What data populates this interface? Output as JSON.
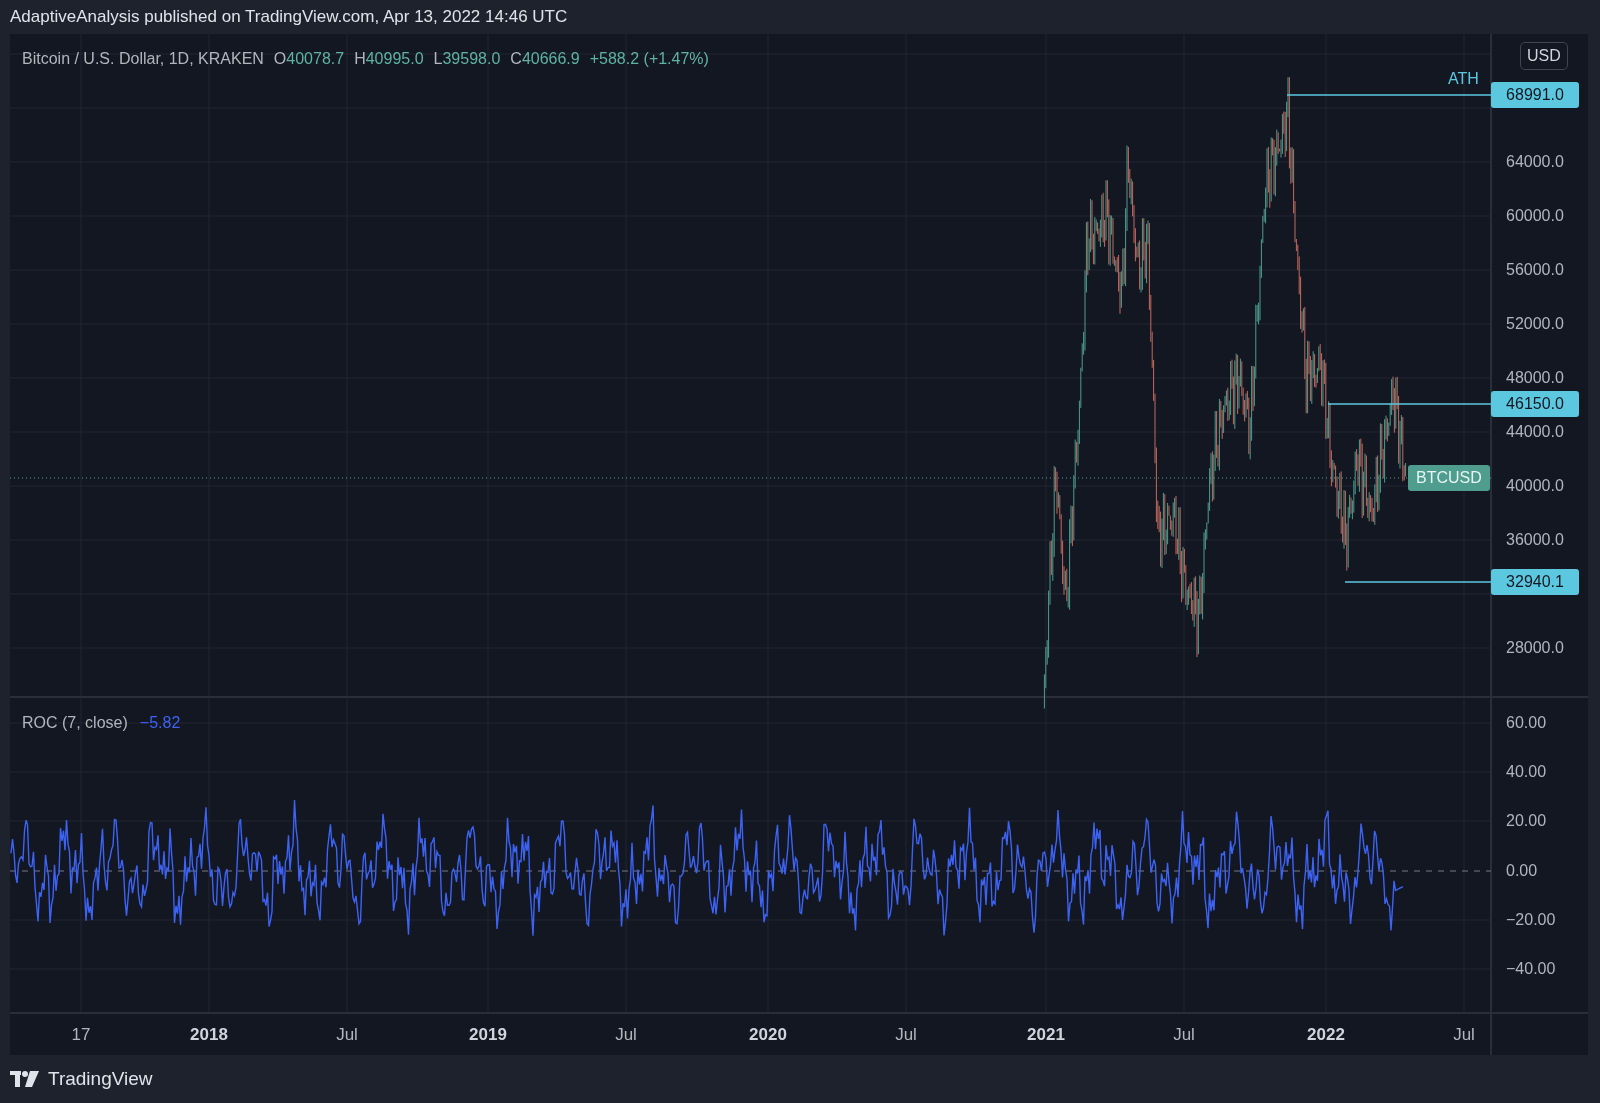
{
  "header": {
    "publish_line": "AdaptiveAnalysis published on TradingView.com, Apr 13, 2022 14:46 UTC"
  },
  "chart": {
    "legend": {
      "symbol": "Bitcoin / U.S. Dollar, 1D, KRAKEN",
      "ohlc": [
        {
          "label": "O",
          "value": "40078.7"
        },
        {
          "label": "H",
          "value": "40995.0"
        },
        {
          "label": "L",
          "value": "39598.0"
        },
        {
          "label": "C",
          "value": "40666.9"
        }
      ],
      "change": "+588.2 (+1.47%)"
    },
    "currency_button": "USD",
    "price_axis": [
      "64000.0",
      "60000.0",
      "56000.0",
      "52000.0",
      "48000.0",
      "44000.0",
      "40000.0",
      "36000.0",
      "28000.0"
    ],
    "price_lines": [
      {
        "label": "ATH",
        "price": "68991.0"
      },
      {
        "price": "46150.0"
      },
      {
        "price": "32940.1"
      }
    ],
    "last_price_tag": "BTCUSD",
    "indicator": {
      "name": "ROC (7, close)",
      "value": "−5.82"
    },
    "indicator_axis": [
      "60.00",
      "40.00",
      "20.00",
      "0.00",
      "−20.00",
      "−40.00"
    ],
    "time_axis": [
      {
        "label": "17",
        "major": false
      },
      {
        "label": "2018",
        "major": true
      },
      {
        "label": "Jul",
        "major": false
      },
      {
        "label": "2019",
        "major": true
      },
      {
        "label": "Jul",
        "major": false
      },
      {
        "label": "2020",
        "major": true
      },
      {
        "label": "Jul",
        "major": false
      },
      {
        "label": "2021",
        "major": true
      },
      {
        "label": "Jul",
        "major": false
      },
      {
        "label": "2022",
        "major": true
      },
      {
        "label": "Jul",
        "major": false
      }
    ]
  },
  "footer": {
    "logo_text": "TradingView"
  }
}
